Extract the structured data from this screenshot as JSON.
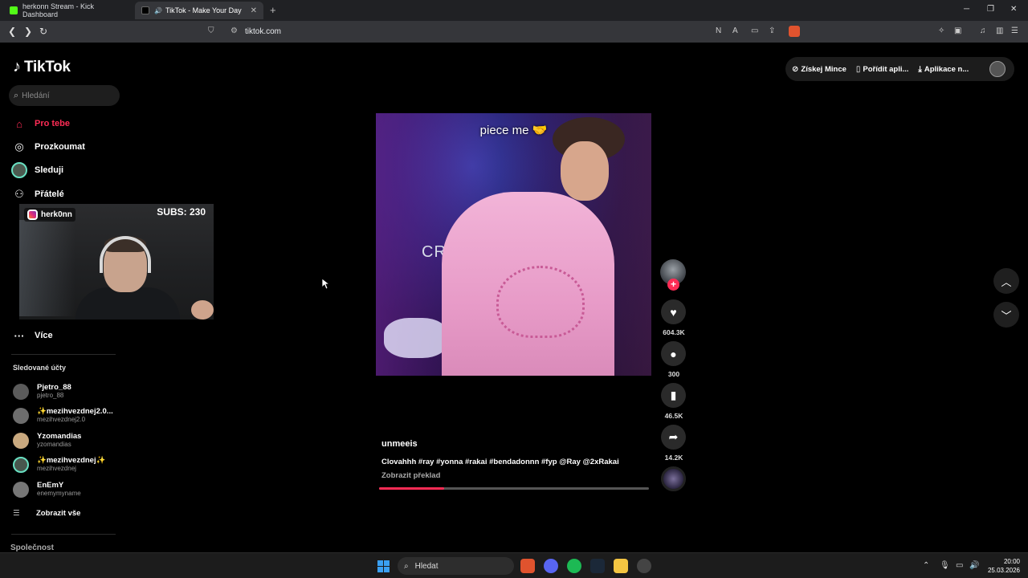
{
  "browser": {
    "tabs": [
      {
        "label": "herkonn Stream - Kick Dashboard"
      },
      {
        "label": "TikTok - Make Your Day"
      }
    ],
    "url": "tiktok.com"
  },
  "tiktok": {
    "logo": "TikTok",
    "search_placeholder": "Hledání",
    "nav": [
      {
        "label": "Pro tebe",
        "icon": "home-icon"
      },
      {
        "label": "Prozkoumat",
        "icon": "compass-icon"
      },
      {
        "label": "Sleduji",
        "icon": "avatar"
      },
      {
        "label": "Přátelé",
        "icon": "friends-icon"
      }
    ],
    "more_label": "Více",
    "followed_title": "Sledované účty",
    "followed": [
      {
        "name": "Pjetro_88",
        "username": "pjetro_88"
      },
      {
        "name": "✨mezihvezdnej2.0...",
        "username": "mezihvezdnej2.0"
      },
      {
        "name": "Yzomandias",
        "username": "yzomandias"
      },
      {
        "name": "✨mezihvezdnej✨",
        "username": "mezihvezdnej"
      },
      {
        "name": "EnEmY",
        "username": "enemymyname"
      }
    ],
    "show_all": "Zobrazit vše",
    "company": "Společnost",
    "top_actions": {
      "coins": "Získej Mince",
      "get_app": "Pořídit apli...",
      "desktop_app": "Aplikace n..."
    },
    "video": {
      "overlay_text": "piece me 🤝",
      "wall_text": "CRE",
      "author": "unmeeis",
      "description": "Clovahhh #ray #yonna #rakai #bendadonnn #fyp @Ray @2xRakai",
      "translate": "Zobrazit překlad",
      "progress": 0.24,
      "likes": "604.3K",
      "comments": "300",
      "saves": "46.5K",
      "shares": "14.2K"
    }
  },
  "stream_overlay": {
    "instagram": "herk0nn",
    "subs": "SUBS: 230"
  },
  "taskbar": {
    "search": "Hledat",
    "time": "20:00",
    "date": "25.03.2026"
  }
}
